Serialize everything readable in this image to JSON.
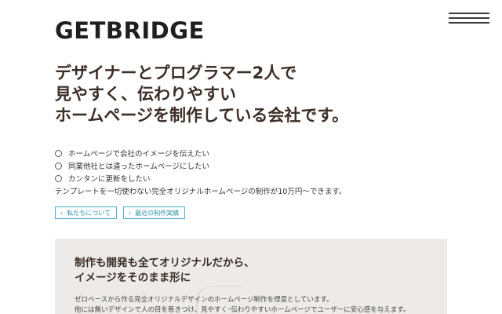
{
  "header": {
    "logo_text": "GETBRIDGE",
    "brand_accent": "#f2d31b"
  },
  "hero": {
    "headline_lines": [
      "デザイナーとプログラマー2人で",
      "見やすく、伝わりやすい",
      "ホームページを制作している会社です。"
    ],
    "checks": [
      "ホームページで会社のイメージを伝えたい",
      "同業他社とは違ったホームページにしたい",
      "カンタンに更新をしたい"
    ],
    "note": "テンプレートを一切使わない完全オリジナルホームページの制作が10万円～できます。",
    "buttons": [
      {
        "label": "私たちについて"
      },
      {
        "label": "最近の制作実績"
      }
    ],
    "accent_color": "#4ab0c9"
  },
  "panel": {
    "title_lines": [
      "制作も開発も全てオリジナルだから、",
      "イメージをそのまま形に"
    ],
    "text_lines": [
      "ゼロベースから作る完全オリジナルデザインのホームページ制作を得意としています。",
      "他には無いデザインで人の目を惹きつけ、見やすく･伝わりやすいホームページでユーザーに安心感を与えます。"
    ]
  }
}
